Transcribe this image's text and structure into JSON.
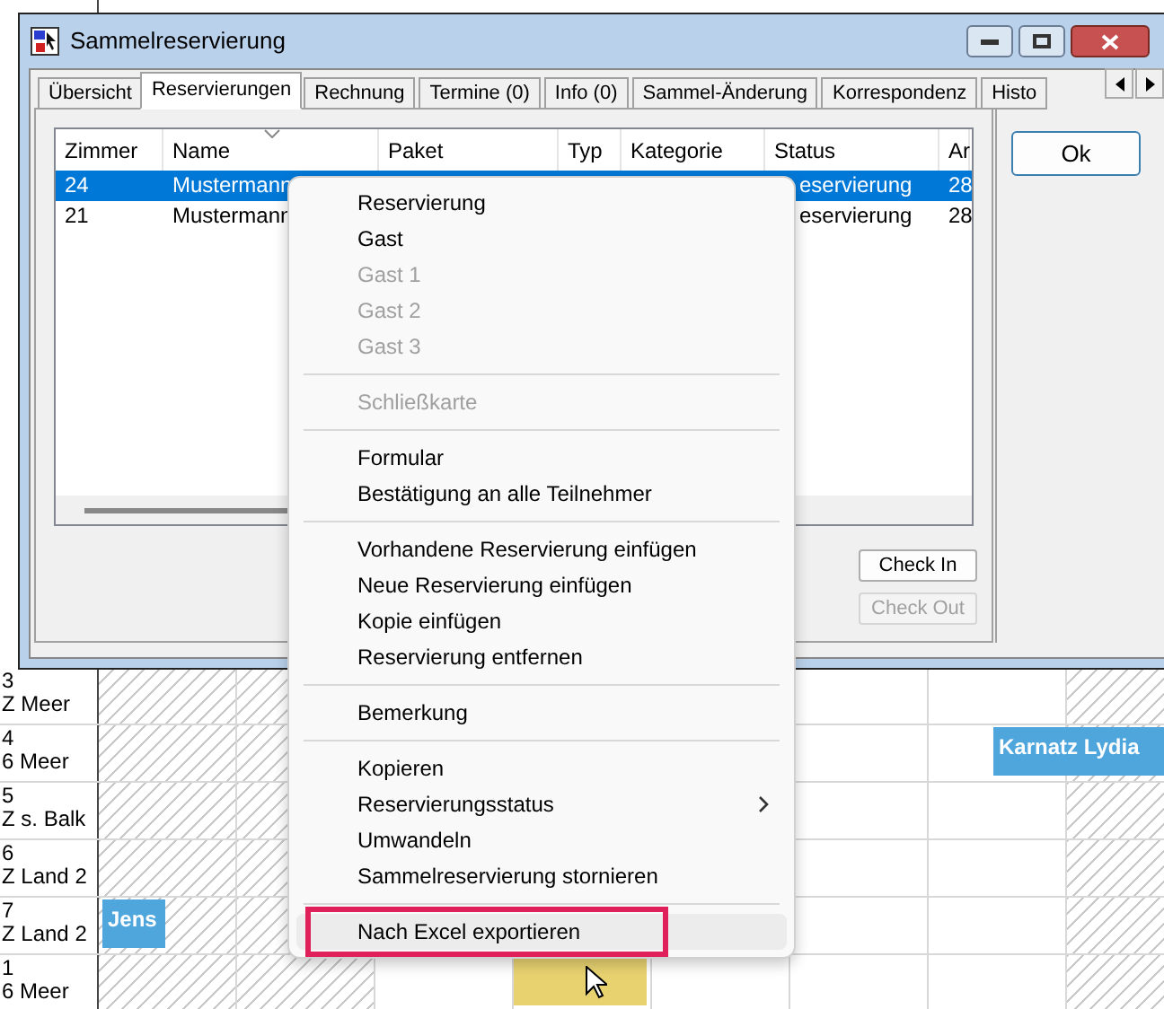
{
  "planner": {
    "rows": [
      {
        "number": "3",
        "room": "Z Meer",
        "bookings": []
      },
      {
        "number": "4",
        "room": "6 Meer",
        "bookings": [
          {
            "label": "Karnatz Lydia",
            "color": "#4ea6dc"
          }
        ]
      },
      {
        "number": "5",
        "room": "Z s. Balk",
        "bookings": []
      },
      {
        "number": "6",
        "room": "Z Land 2",
        "bookings": []
      },
      {
        "number": "7",
        "room": "Z Land 2",
        "bookings": [
          {
            "label": "Jens",
            "color": "#4ea6dc"
          }
        ]
      },
      {
        "number": "1",
        "room": "6 Meer",
        "bookings": [
          {
            "color": "#e8d270"
          }
        ]
      }
    ]
  },
  "window": {
    "title": "Sammelreservierung"
  },
  "tabs": [
    {
      "label": "Übersicht",
      "selected": false
    },
    {
      "label": "Reservierungen",
      "selected": true
    },
    {
      "label": "Rechnung",
      "selected": false
    },
    {
      "label": "Termine (0)",
      "selected": false
    },
    {
      "label": "Info (0)",
      "selected": false
    },
    {
      "label": "Sammel-Änderung",
      "selected": false
    },
    {
      "label": "Korrespondenz",
      "selected": false
    },
    {
      "label": "Histo",
      "selected": false
    }
  ],
  "table": {
    "columns": [
      "Zimmer",
      "Name",
      "Paket",
      "Typ",
      "Kategorie",
      "Status",
      "Ar"
    ],
    "rows": [
      {
        "selected": true,
        "cells": [
          "24",
          "Mustermann",
          "",
          "",
          "",
          "eservierung",
          "28"
        ]
      },
      {
        "selected": false,
        "cells": [
          "21",
          "Mustermann",
          "",
          "",
          "",
          "eservierung",
          "28"
        ]
      }
    ]
  },
  "buttons": [
    {
      "label": "Check In",
      "disabled": false
    },
    {
      "label": "Check Out",
      "disabled": true
    }
  ],
  "ok_button": "Ok",
  "context_menu": [
    {
      "kind": "item",
      "label": "Reservierung",
      "disabled": false
    },
    {
      "kind": "item",
      "label": "Gast",
      "disabled": false
    },
    {
      "kind": "item",
      "label": "Gast 1",
      "disabled": true
    },
    {
      "kind": "item",
      "label": "Gast 2",
      "disabled": true
    },
    {
      "kind": "item",
      "label": "Gast 3",
      "disabled": true
    },
    {
      "kind": "separator"
    },
    {
      "kind": "item",
      "label": "Schließkarte",
      "disabled": true
    },
    {
      "kind": "separator"
    },
    {
      "kind": "item",
      "label": "Formular",
      "disabled": false
    },
    {
      "kind": "item",
      "label": "Bestätigung an alle Teilnehmer",
      "disabled": false
    },
    {
      "kind": "separator"
    },
    {
      "kind": "item",
      "label": "Vorhandene Reservierung einfügen",
      "disabled": false
    },
    {
      "kind": "item",
      "label": "Neue Reservierung einfügen",
      "disabled": false
    },
    {
      "kind": "item",
      "label": "Kopie einfügen",
      "disabled": false
    },
    {
      "kind": "item",
      "label": "Reservierung entfernen",
      "disabled": false
    },
    {
      "kind": "separator"
    },
    {
      "kind": "item",
      "label": "Bemerkung",
      "disabled": false
    },
    {
      "kind": "separator"
    },
    {
      "kind": "item",
      "label": "Kopieren",
      "disabled": false
    },
    {
      "kind": "submenu",
      "label": "Reservierungsstatus",
      "disabled": false
    },
    {
      "kind": "item",
      "label": "Umwandeln",
      "disabled": false
    },
    {
      "kind": "item",
      "label": "Sammelreservierung stornieren",
      "disabled": false
    },
    {
      "kind": "separator"
    },
    {
      "kind": "item",
      "label": "Nach Excel exportieren",
      "disabled": false,
      "highlighted": true
    }
  ]
}
